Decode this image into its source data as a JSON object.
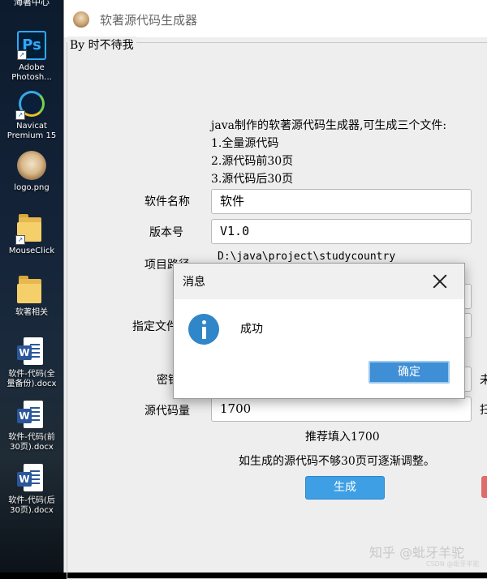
{
  "desktop": {
    "top_label": "海著中心",
    "icons": [
      {
        "name": "photoshop-icon",
        "label": "Adobe\nPhotosh...",
        "glyph": "Ps"
      },
      {
        "name": "navicat-icon",
        "label": "Navicat\nPremium 15"
      },
      {
        "name": "image-file-icon",
        "label": "logo.png"
      },
      {
        "name": "folder-icon",
        "label": "MouseClick"
      },
      {
        "name": "folder-icon",
        "label": "软著相关"
      },
      {
        "name": "word-doc-icon",
        "label": "软件-代码(全\n量备份).docx",
        "glyph": "W"
      },
      {
        "name": "word-doc-icon",
        "label": "软件-代码(前\n30页).docx",
        "glyph": "W"
      },
      {
        "name": "word-doc-icon",
        "label": "软件-代码(后\n30页).docx",
        "glyph": "W"
      }
    ]
  },
  "window": {
    "title": "软著源代码生成器",
    "group_title": "By 时不待我",
    "description": [
      "java制作的软著源代码生成器,可生成三个文件:",
      "1.全量源代码",
      "2.源代码前30页",
      "3.源代码后30页"
    ],
    "fields": {
      "software_name": {
        "label": "软件名称",
        "value": "软件"
      },
      "version": {
        "label": "版本号",
        "value": "V1.0"
      },
      "project_path": {
        "label": "项目路径",
        "value": "D:\\java\\project\\studycountry"
      },
      "specified_file": {
        "label": "指定文件"
      },
      "password": {
        "label": "密钥"
      },
      "code_lines": {
        "label": "源代码量",
        "value": "1700"
      }
    },
    "side_chars": {
      "row_password": "未",
      "row_code": "扫"
    },
    "hint_recommend": "推荐填入1700",
    "hint_adjust": "如生成的源代码不够30页可逐渐调整。",
    "generate_button": "生成",
    "watermark": "知乎 @蚍牙羊驼",
    "watermark_small": "CSDN @蚍牙羊驼"
  },
  "dialog": {
    "title": "消息",
    "message": "成功",
    "ok_button": "确定"
  },
  "colors": {
    "primary_button": "#3f9fe4",
    "info_icon": "#2f86c9",
    "window_bg": "#eeeeee"
  }
}
